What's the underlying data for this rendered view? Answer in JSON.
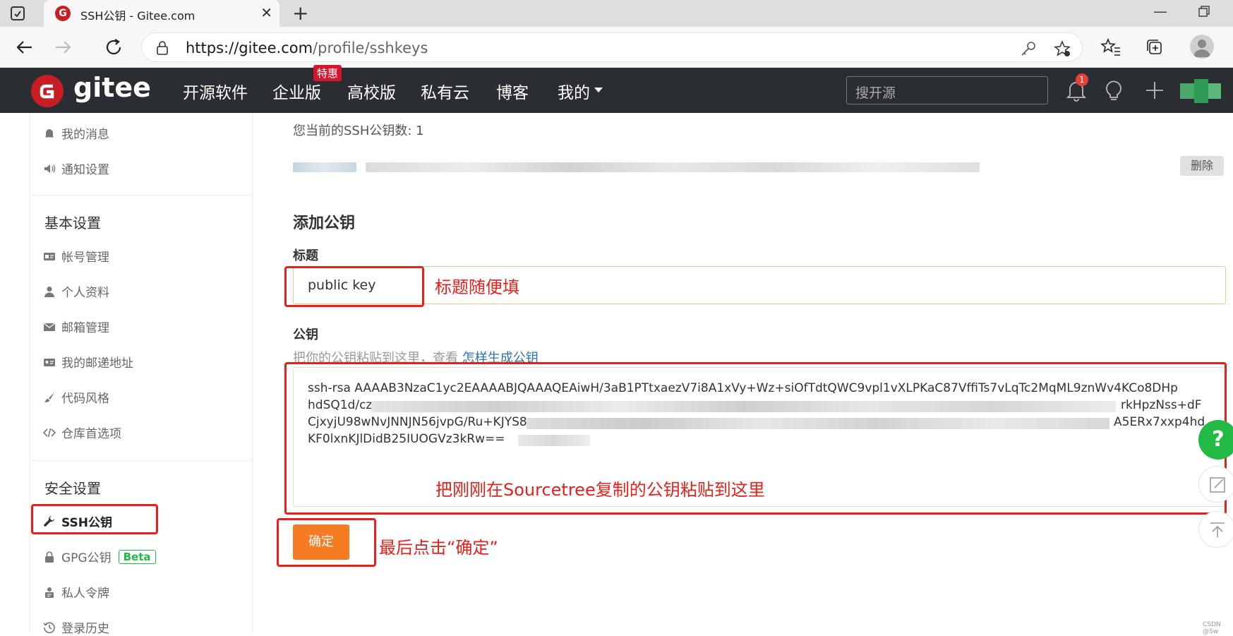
{
  "browser": {
    "tab_title": "SSH公钥 - Gitee.com",
    "url_host": "https://gitee.com",
    "url_path": "/profile/sshkeys"
  },
  "header": {
    "logo": "gitee",
    "nav": [
      "开源软件",
      "企业版",
      "高校版",
      "私有云",
      "博客",
      "我的"
    ],
    "enterprise_badge": "特惠",
    "search_placeholder": "搜开源",
    "notification_count": "1"
  },
  "sidebar": {
    "top_items": [
      "我的消息",
      "通知设置"
    ],
    "basic_heading": "基本设置",
    "basic_items": [
      "帐号管理",
      "个人资料",
      "邮箱管理",
      "我的邮递地址",
      "代码风格",
      "仓库首选项"
    ],
    "security_heading": "安全设置",
    "security_items": [
      "SSH公钥",
      "GPG公钥",
      "私人令牌",
      "登录历史"
    ],
    "beta_label": "Beta"
  },
  "main": {
    "key_count": "您当前的SSH公钥数: 1",
    "delete_label": "删除",
    "add_heading": "添加公钥",
    "title_label": "标题",
    "title_value": "public key",
    "key_label": "公钥",
    "key_hint": "把你的公钥粘贴到这里，查看",
    "key_hint_link": "怎样生成公钥",
    "key_lines": [
      "ssh-rsa AAAAB3NzaC1yc2EAAAABJQAAAQEAiwH/3aB1PTtxaezV7i8A1xVy+Wz+siOfTdtQWC9vpl1vXLPKaC87VffiTs7vLqTc2MqML9znWv4KCo8DHp",
      "hdSQ1d/cz",
      "CjxyjU98wNvJNNJN56jvpG/Ru+KJYS8",
      "KF0lxnKJlDidB25IUOGVz3kRw=="
    ],
    "key_line2_tail": "rkHpzNss+dF",
    "key_line3_tail": "A5ERx7xxp4hd",
    "confirm_label": "确定"
  },
  "annotations": {
    "title_note": "标题随便填",
    "key_note": "把刚刚在Sourcetree复制的公钥粘贴到这里",
    "confirm_note": "最后点击“确定”"
  },
  "watermark": "CSDN @Sw",
  "colors": {
    "gitee_red": "#c71d23",
    "header_bg": "#2a2d31",
    "confirm_orange": "#f57c22",
    "annotation_red": "#e8201c",
    "beta_green": "#21ba45"
  }
}
